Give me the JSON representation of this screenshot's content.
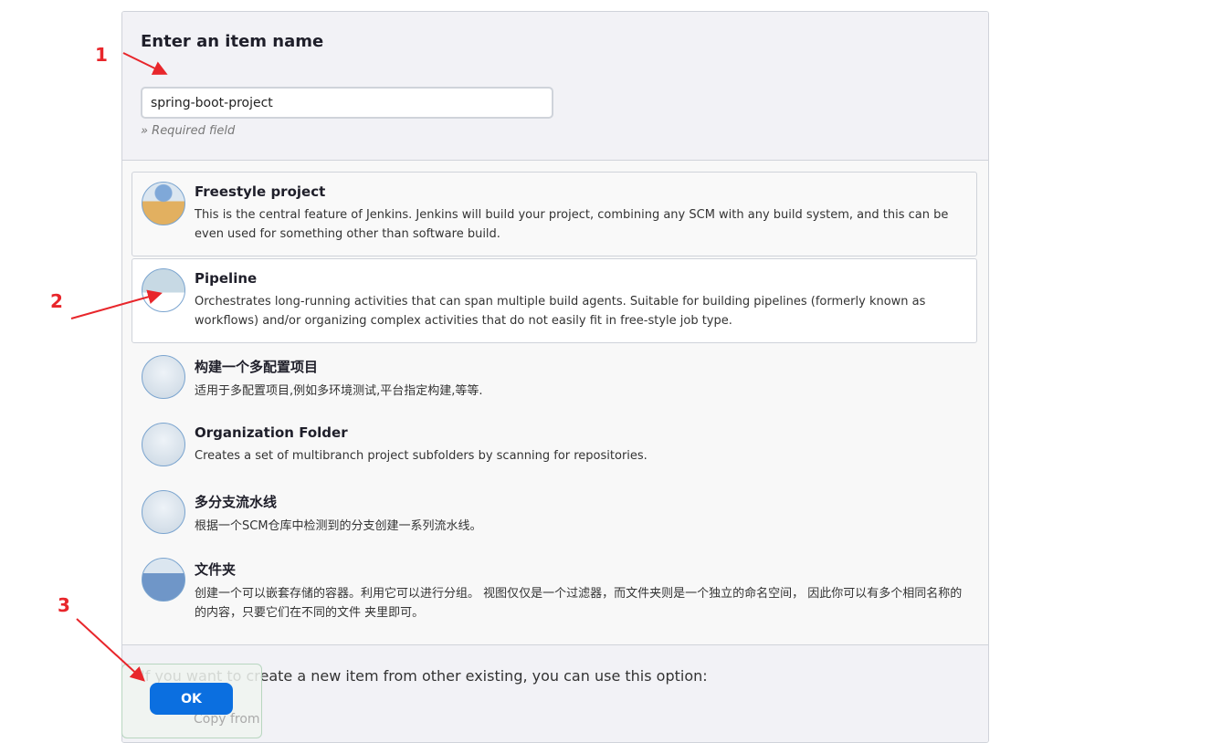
{
  "header": {
    "title": "Enter an item name",
    "item_name": "spring-boot-project",
    "required": "» Required field"
  },
  "items": [
    {
      "title": "Freestyle project",
      "desc": "This is the central feature of Jenkins. Jenkins will build your project, combining any SCM with any build system, and this can be even used for something other than software build.",
      "icon": "freestyle-box-icon"
    },
    {
      "title": "Pipeline",
      "desc": "Orchestrates long-running activities that can span multiple build agents. Suitable for building pipelines (formerly known as workflows) and/or organizing complex activities that do not easily fit in free-style job type.",
      "icon": "pipeline-icon"
    },
    {
      "title": "构建一个多配置项目",
      "desc": "适用于多配置项目,例如多环境测试,平台指定构建,等等.",
      "icon": "multi-config-icon"
    },
    {
      "title": "Organization Folder",
      "desc": "Creates a set of multibranch project subfolders by scanning for repositories.",
      "icon": "organization-folder-icon"
    },
    {
      "title": "多分支流水线",
      "desc": "根据一个SCM仓库中检测到的分支创建一系列流水线。",
      "icon": "multibranch-icon"
    },
    {
      "title": "文件夹",
      "desc": "创建一个可以嵌套存储的容器。利用它可以进行分组。 视图仅仅是一个过滤器，而文件夹则是一个独立的命名空间， 因此你可以有多个相同名称的的内容，只要它们在不同的文件 夹里即可。",
      "icon": "folder-icon"
    }
  ],
  "copy": {
    "text": "If you want to create a new item from other existing, you can use this option:",
    "copy_from": "Copy from"
  },
  "ok_label": "OK",
  "annotations": [
    "1",
    "2",
    "3"
  ],
  "colors": {
    "accent": "#0b6fe0",
    "annotation": "#e8262b"
  }
}
